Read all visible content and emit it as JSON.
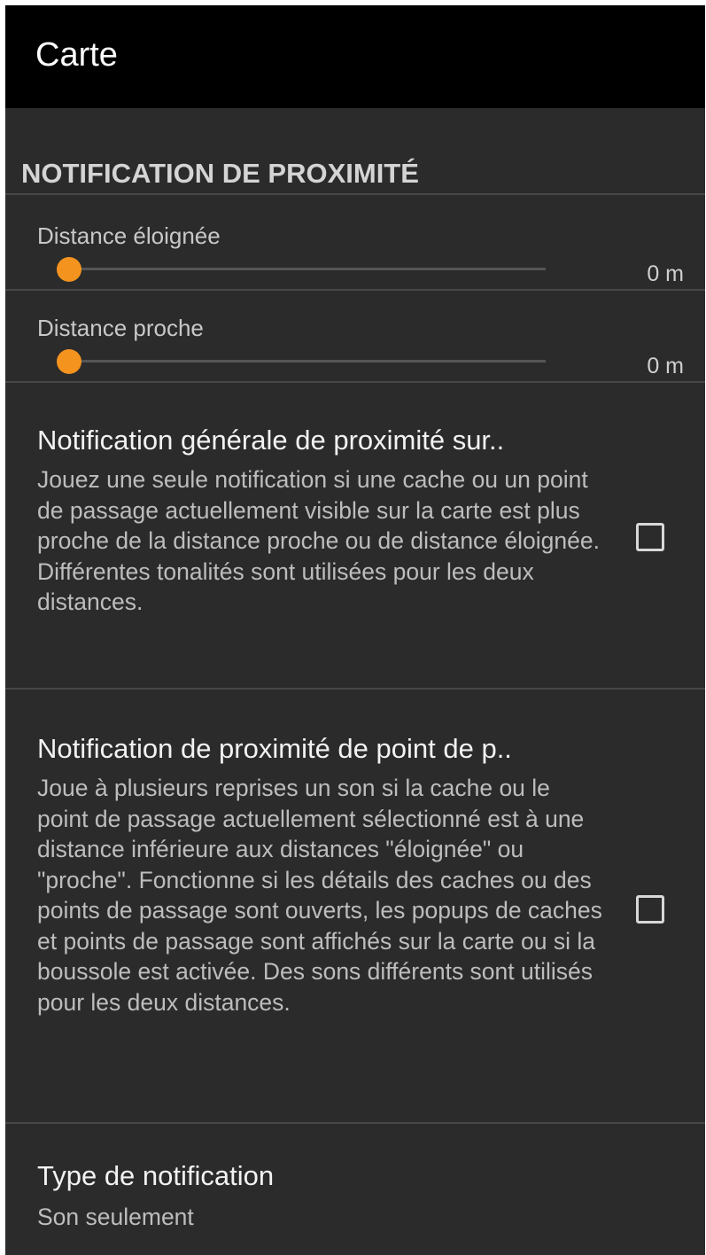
{
  "toolbar": {
    "title": "Carte"
  },
  "section": {
    "header": "NOTIFICATION DE PROXIMITÉ"
  },
  "sliders": [
    {
      "label": "Distance éloignée",
      "value_text": "0 m",
      "value": 0
    },
    {
      "label": "Distance proche",
      "value_text": "0 m",
      "value": 0
    }
  ],
  "prefs": [
    {
      "title": "Notification générale de proximité sur..",
      "summary": "Jouez une seule notification si une cache ou un point de passage actuellement visible sur la carte est plus proche de la distance proche ou de distance éloignée. Différentes tonalités sont utilisées pour les deux distances.",
      "checked": false
    },
    {
      "title": "Notification de proximité de point de p..",
      "summary": "Joue à plusieurs reprises un son si la cache ou le point de passage actuellement sélectionné est à une distance inférieure aux distances \"éloignée\" ou \"proche\". Fonctionne si les détails des caches ou des points de passage sont ouverts, les popups de caches et points de passage sont affichés sur la carte ou si la boussole est activée. Des sons différents sont utilisés pour les deux distances.",
      "checked": false
    }
  ],
  "notification_type": {
    "title": "Type de notification",
    "summary": "Son seulement"
  },
  "colors": {
    "accent": "#f5931f",
    "background": "#2b2b2b",
    "toolbar": "#000000"
  }
}
